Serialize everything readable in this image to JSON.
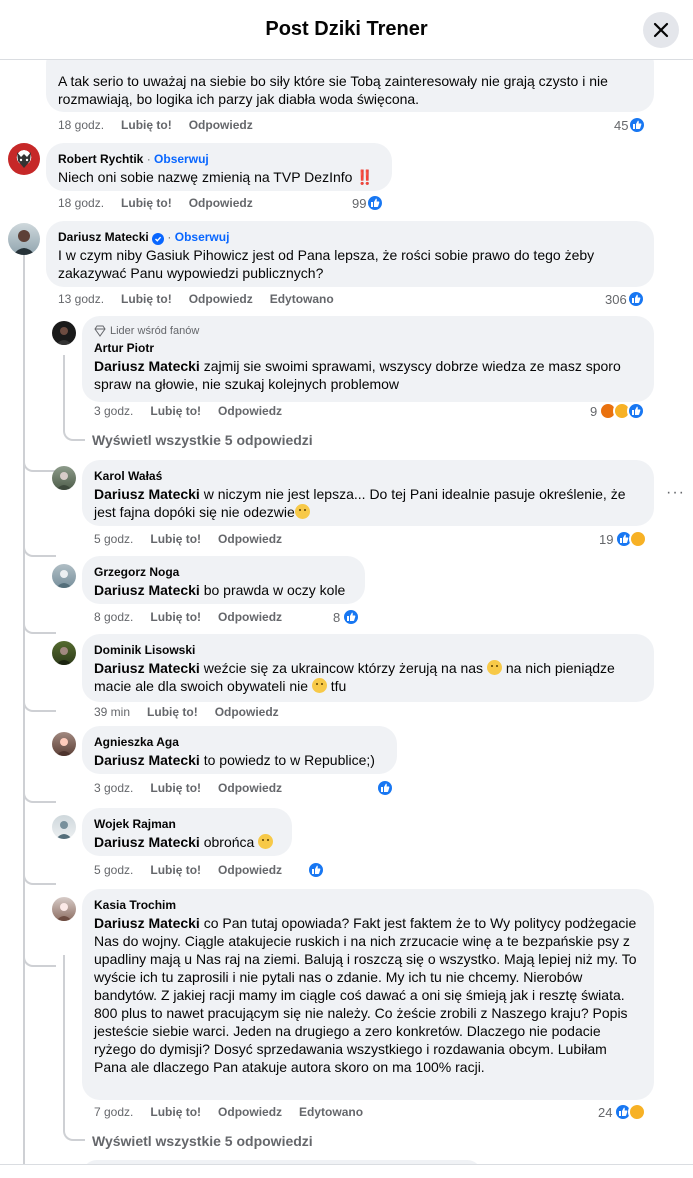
{
  "header": {
    "title": "Post Dziki Trener"
  },
  "comments": [
    {
      "id": "c0",
      "text": "A tak serio to uważaj na siebie bo siły które sie Tobą zainteresowały nie grają czysto i nie rozmawiają, bo logika ich parzy jak diabła woda święcona.",
      "time": "18 godz.",
      "like": "Lubię to!",
      "reply": "Odpowiedz",
      "reactions": "45"
    },
    {
      "id": "c1",
      "author": "Robert Rychtik",
      "follow": "Obserwuj",
      "text": "Niech oni sobie nazwę zmienią na TVP DezInfo",
      "emoji": "‼️",
      "time": "18 godz.",
      "like": "Lubię to!",
      "reply": "Odpowiedz",
      "reactions": "99"
    },
    {
      "id": "c2",
      "author": "Dariusz Matecki",
      "follow": "Obserwuj",
      "text": "I w czym niby Gasiuk Pihowicz jest od Pana lepsza, że rości sobie prawo do tego żeby zakazywać Panu wypowiedzi publicznych?",
      "time": "13 godz.",
      "like": "Lubię to!",
      "reply": "Odpowiedz",
      "edited": "Edytowano",
      "reactions": "306"
    }
  ],
  "replies": [
    {
      "id": "r1",
      "badge": "Lider wśród fanów",
      "author": "Artur Piotr",
      "mention": "Dariusz Matecki",
      "text": " zajmij sie swoimi sprawami, wszyscy dobrze wiedza ze masz sporo spraw na głowie, nie szukaj kolejnych problemow",
      "time": "3 godz.",
      "like": "Lubię to!",
      "reply": "Odpowiedz",
      "reactions": "9"
    },
    {
      "id": "r2",
      "author": "Karol Wałaś",
      "mention": "Dariusz Matecki",
      "text": " w niczym nie jest lepsza... Do tej Pani idealnie pasuje określenie, że jest fajna dopóki się nie odezwie",
      "time": "5 godz.",
      "like": "Lubię to!",
      "reply": "Odpowiedz",
      "reactions": "19"
    },
    {
      "id": "r3",
      "author": "Grzegorz Noga",
      "mention": "Dariusz Matecki",
      "text": " bo prawda w oczy kole",
      "time": "8 godz.",
      "like": "Lubię to!",
      "reply": "Odpowiedz",
      "reactions": "8"
    },
    {
      "id": "r4",
      "author": "Dominik Lisowski",
      "mention": "Dariusz Matecki",
      "text_a": " weźcie się za ukraincow którzy żerują na nas ",
      "text_b": " na nich pieniądze macie ale dla swoich obywateli nie ",
      "text_c": " tfu",
      "time": "39 min",
      "like": "Lubię to!",
      "reply": "Odpowiedz"
    },
    {
      "id": "r5",
      "author": "Agnieszka Aga",
      "mention": "Dariusz Matecki",
      "text": " to powiedz to w Republice;)",
      "time": "3 godz.",
      "like": "Lubię to!",
      "reply": "Odpowiedz"
    },
    {
      "id": "r6",
      "author": "Wojek Rajman",
      "mention": "Dariusz Matecki",
      "text": " obrońca ",
      "time": "5 godz.",
      "like": "Lubię to!",
      "reply": "Odpowiedz"
    },
    {
      "id": "r7",
      "author": "Kasia Trochim",
      "mention": "Dariusz Matecki",
      "text": " co Pan tutaj opowiada? Fakt jest faktem że to Wy politycy podżegacie Nas do wojny. Ciągle atakujecie ruskich i na nich zrzucacie winę a te bezpańskie psy z upadliny mają u Nas raj na ziemi. Balują i roszczą się o wszystko. Mają lepiej niż my. To wyście ich tu zaprosili i nie pytali nas o zdanie. My ich tu nie chcemy. Nierobów bandytów. Z jakiej racji mamy im ciągle coś dawać a oni się śmieją jak i resztę świata. 800 plus to nawet pracującym się nie należy. Co żeście zrobili z Naszego kraju? Popis jesteście siebie warci. Jeden na drugiego a zero konkretów. Dlaczego nie podacie ryżego do dymisji? Dosyć sprzedawania wszystkiego i rozdawania obcym. Lubiłam Pana ale dlaczego Pan atakuje autora skoro on ma 100% racji.",
      "time": "7 godz.",
      "like": "Lubię to!",
      "reply": "Odpowiedz",
      "edited": "Edytowano",
      "reactions": "24"
    }
  ],
  "view_replies_label": "Wyświetl wszystkie 5 odpowiedzi",
  "colors": {
    "like_blue": "#1877f2",
    "link_blue": "#0866ff",
    "bubble": "#f0f2f5",
    "meta_gray": "#65676b"
  }
}
